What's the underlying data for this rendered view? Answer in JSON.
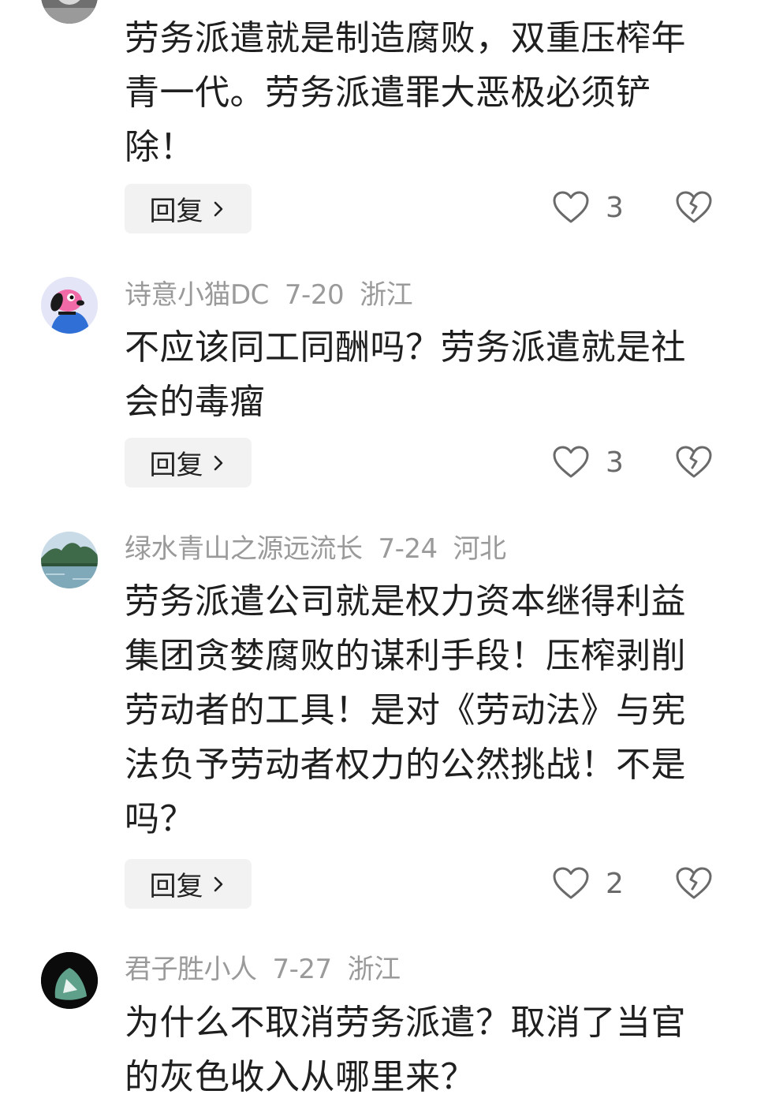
{
  "comments": [
    {
      "author": "",
      "date": "",
      "location": "",
      "text": "劳务派遣就是制造腐败，双重压榨年青一代。劳务派遣罪大恶极必须铲除！",
      "reply_label": "回复",
      "likes": "3",
      "avatar": "partial-avatar-icon"
    },
    {
      "author": "诗意小猫DC",
      "date": "7-20",
      "location": "浙江",
      "text": "不应该同工同酬吗？劳务派遣就是社会的毒瘤",
      "reply_label": "回复",
      "likes": "3",
      "avatar": "cartoon-dog-avatar-icon"
    },
    {
      "author": "绿水青山之源远流长",
      "date": "7-24",
      "location": "河北",
      "text": "劳务派遣公司就是权力资本继得利益集团贪婪腐败的谋利手段！压榨剥削劳动者的工具！是对《劳动法》与宪法负予劳动者权力的公然挑战！不是吗？",
      "reply_label": "回复",
      "likes": "2",
      "avatar": "landscape-avatar-icon"
    },
    {
      "author": "君子胜小人",
      "date": "7-27",
      "location": "浙江",
      "text": "为什么不取消劳务派遣？取消了当官的灰色收入从哪里来？",
      "avatar": "jade-avatar-icon"
    }
  ],
  "colors": {
    "meta_text": "#9a9a9a",
    "body_text": "#1f1f1f",
    "reply_bg": "#f2f2f2",
    "icon_stroke": "#6a6a6a"
  }
}
